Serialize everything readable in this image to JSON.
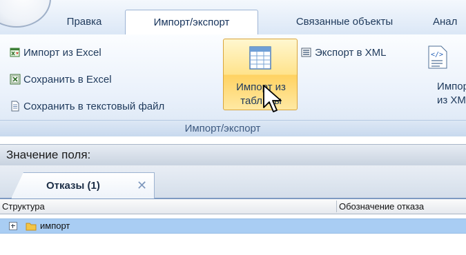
{
  "ribbon_tabs": [
    "Правка",
    "Импорт/экспорт",
    "Связанные объекты",
    "Анал"
  ],
  "active_tab": "Импорт/экспорт",
  "buttons": {
    "import_excel": "Импорт из Excel",
    "save_excel": "Сохранить в Excel",
    "save_text": "Сохранить в текстовый файл",
    "export_xml": "Экспорт в XML",
    "import_table_line1": "Импорт из",
    "import_table_line2": "таблицы",
    "import_xml_line1": "Импор",
    "import_xml_line2": "из XMI"
  },
  "group_caption": "Импорт/экспорт",
  "field_value_label": "Значение поля:",
  "document_tab": {
    "title": "Отказы (1)",
    "close": "✕"
  },
  "grid": {
    "columns": [
      "Структура",
      "Обозначение отказа"
    ],
    "rows": [
      {
        "label": "импорт",
        "expand": "+"
      }
    ]
  },
  "colors": {
    "ribbon_text": "#1e395b",
    "hover_button": "#ffd262",
    "selected_row": "#a9cdf3"
  }
}
